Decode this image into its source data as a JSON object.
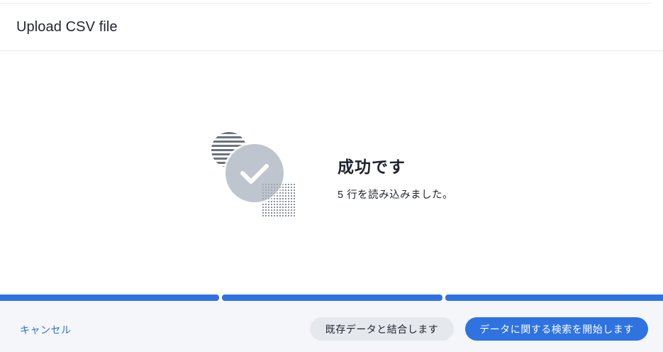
{
  "dialog": {
    "title": "Upload CSV file"
  },
  "result": {
    "title": "成功です",
    "detail": "5 行を読み込みました。",
    "icon": "success-check-icon"
  },
  "progress": {
    "steps_total": 3,
    "steps_completed": 3,
    "color": "#2f73e0"
  },
  "footer": {
    "cancel_label": "キャンセル",
    "merge_label": "既存データと結合します",
    "search_label": "データに関する検索を開始します"
  },
  "colors": {
    "accent": "#2f73e0",
    "link": "#2f6fd6",
    "illustration_gray": "#bfc5cf",
    "illustration_dark": "#6b7280"
  }
}
